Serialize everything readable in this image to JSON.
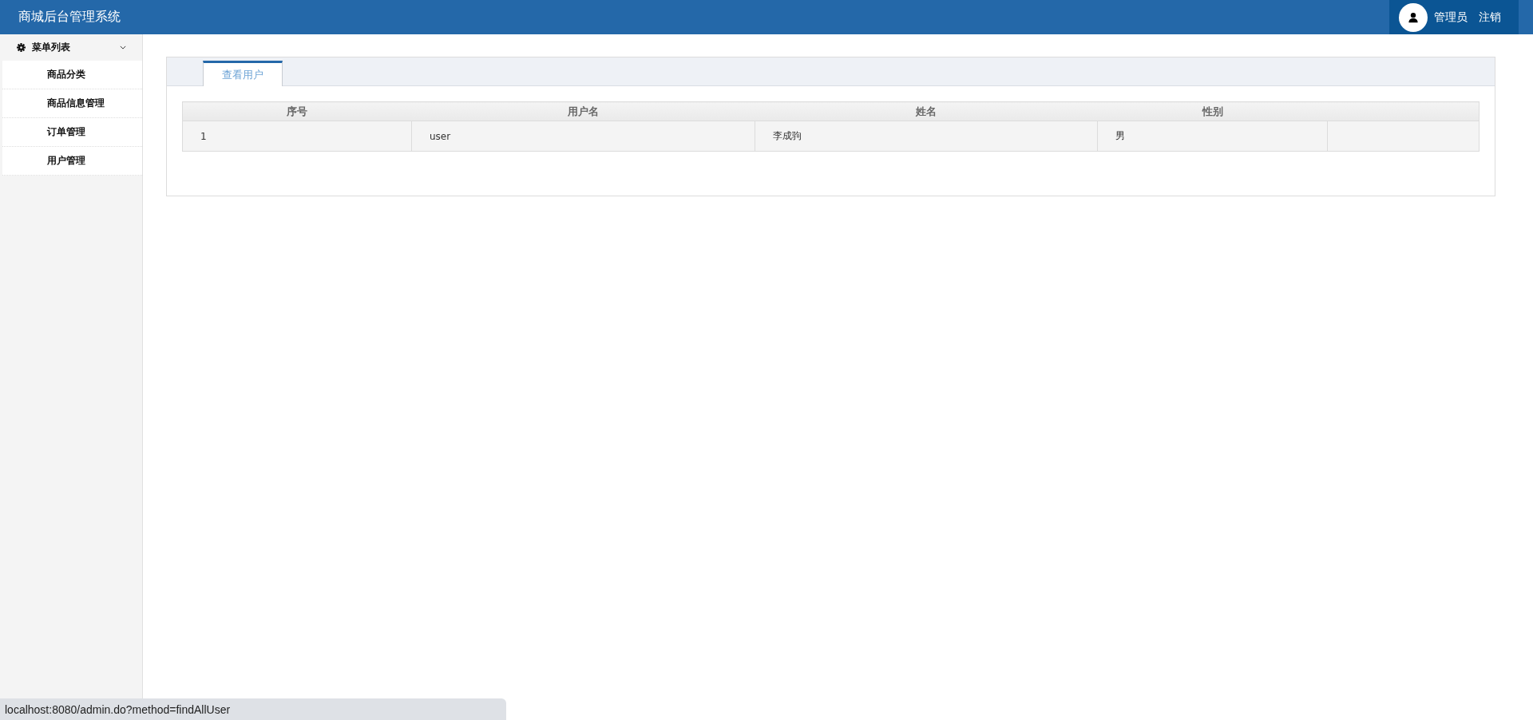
{
  "header": {
    "title": "商城后台管理系统",
    "user": "管理员",
    "logout": "注销"
  },
  "sidebar": {
    "title": "菜单列表",
    "expanded": true,
    "items": [
      {
        "label": "商品分类"
      },
      {
        "label": "商品信息管理"
      },
      {
        "label": "订单管理"
      },
      {
        "label": "用户管理"
      }
    ]
  },
  "tabs": [
    {
      "label": "查看用户",
      "selected": true
    }
  ],
  "table": {
    "columns": [
      "序号",
      "用户名",
      "姓名",
      "性别"
    ],
    "rows": [
      [
        "1",
        "user",
        "李成驹",
        "男"
      ]
    ]
  },
  "status_bar": "localhost:8080/admin.do?method=findAllUser"
}
